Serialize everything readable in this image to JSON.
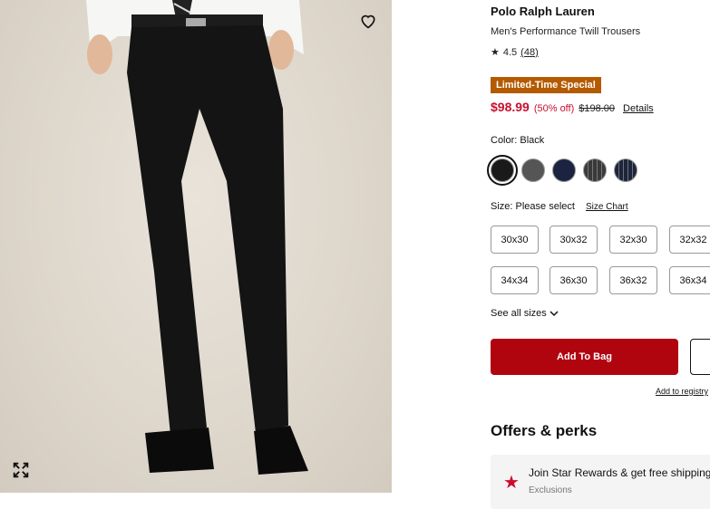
{
  "product": {
    "brand": "Polo Ralph Lauren",
    "name": "Men's Performance Twill Trousers",
    "rating": "4.5",
    "review_count": "(48)",
    "promo_badge": "Limited-Time Special",
    "sale_price": "$98.99",
    "discount": "(50% off)",
    "original_price": "$198.00",
    "details_link": "Details"
  },
  "color": {
    "label": "Color: Black",
    "swatches": [
      {
        "name": "black",
        "hex": "#1a1a1a",
        "selected": true
      },
      {
        "name": "charcoal",
        "hex": "#555555"
      },
      {
        "name": "navy",
        "hex": "#1b2340"
      },
      {
        "name": "charcoal-pinstripe",
        "hex": "#3a3a3a"
      },
      {
        "name": "navy-pinstripe",
        "hex": "#1e2536"
      }
    ]
  },
  "size": {
    "label": "Size: Please select",
    "chart_link": "Size Chart",
    "options": [
      "30x30",
      "30x32",
      "32x30",
      "32x32",
      "34x34",
      "36x30",
      "36x32",
      "36x34"
    ],
    "see_all": "See all sizes"
  },
  "actions": {
    "add_to_bag": "Add To Bag",
    "add_to_registry": "Add to registry"
  },
  "offers": {
    "heading": "Offers & perks",
    "card_text": "Join Star Rewards & get free shipping",
    "card_sub": "Exclusions"
  },
  "colors": {
    "accent_red": "#b0050f",
    "promo_orange": "#b45a00",
    "sale_red": "#c8102e"
  }
}
